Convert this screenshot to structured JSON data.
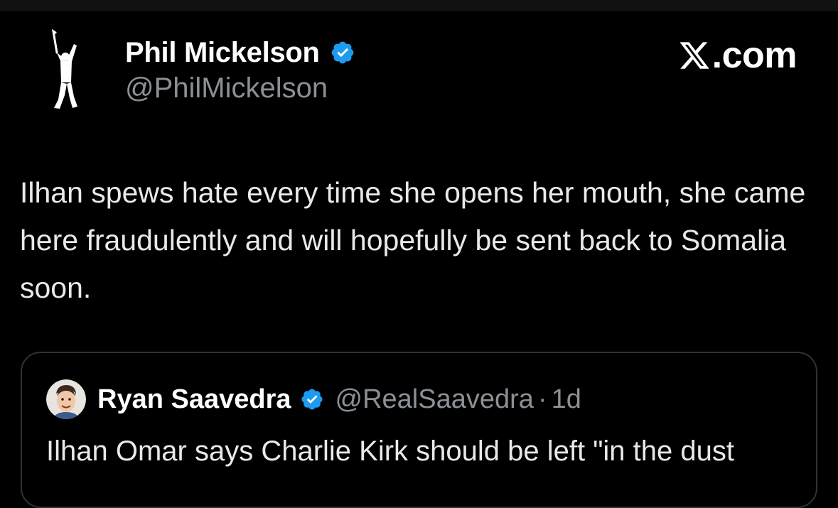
{
  "post": {
    "author": {
      "name": "Phil Mickelson",
      "handle": "@PhilMickelson",
      "verified": true,
      "avatar_icon": "golfer-silhouette-icon"
    },
    "source": {
      "logo_icon": "x-logo-icon",
      "text": ".com"
    },
    "text": "Ilhan spews hate every time she opens her mouth, she came here fraudulently and will hopefully be sent back to Somalia soon."
  },
  "quoted_post": {
    "author": {
      "name": "Ryan Saavedra",
      "handle": "@RealSaavedra",
      "verified": true,
      "avatar_icon": "cartoon-face-avatar-icon"
    },
    "separator": "·",
    "time": "1d",
    "text": "Ilhan Omar says Charlie Kirk should be left \"in the dust"
  },
  "colors": {
    "background": "#000000",
    "primary_text": "#e7e9ea",
    "secondary_text": "#8b9096",
    "verified_blue": "#1d9bf0",
    "card_border": "#2f3336"
  }
}
